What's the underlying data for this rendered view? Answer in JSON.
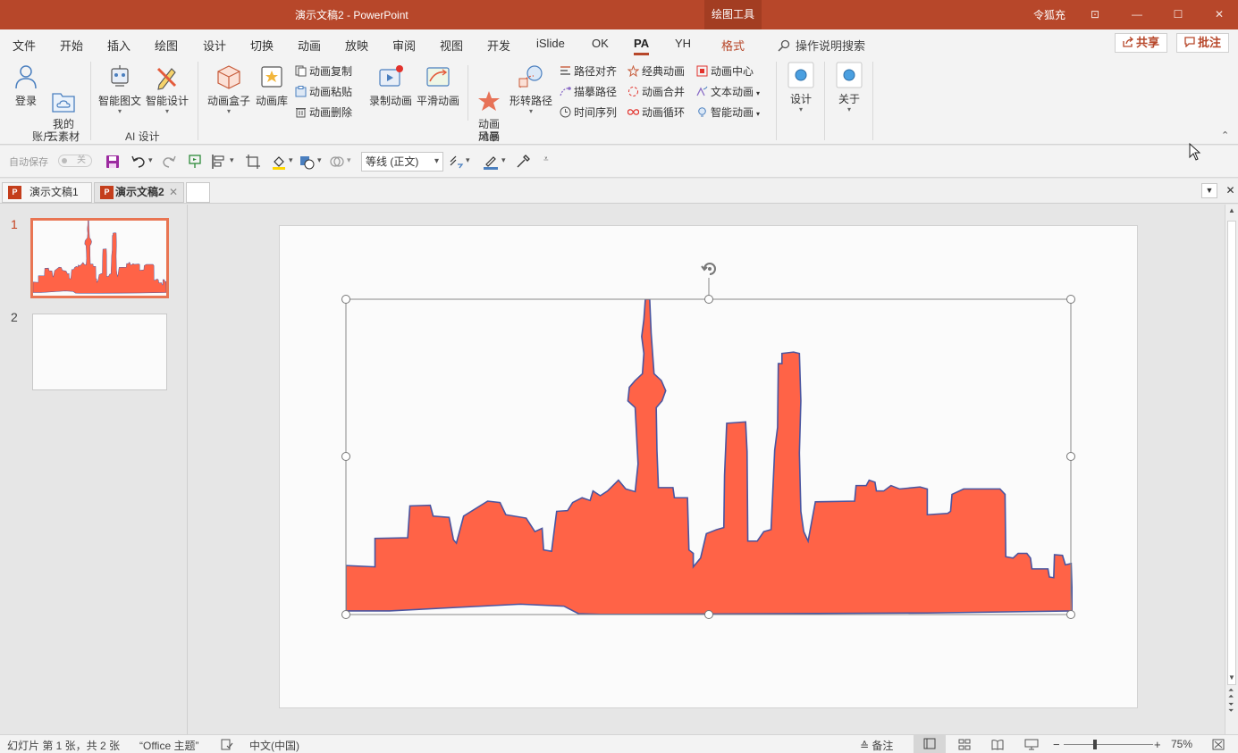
{
  "titlebar": {
    "title": "演示文稿2  -  PowerPoint",
    "tools_badge": "绘图工具",
    "user": "令狐充",
    "btn_ribbon_options": "⊡",
    "btn_minimize": "—",
    "btn_maximize": "☐",
    "btn_close": "✕"
  },
  "menu": {
    "tabs": [
      "文件",
      "开始",
      "插入",
      "绘图",
      "设计",
      "切换",
      "动画",
      "放映",
      "审阅",
      "视图",
      "开发",
      "iSlide",
      "OK",
      "PA",
      "YH",
      "格式"
    ],
    "active_tab": "PA",
    "search": "操作说明搜索",
    "share": "共享",
    "comments": "批注"
  },
  "ribbon": {
    "account_group": {
      "label": "账户",
      "login": "登录",
      "my_assets": "我的\n云素材"
    },
    "ai_group": {
      "label": "AI 设计",
      "smart_graphics": "智能图文",
      "smart_design": "智能设计"
    },
    "anim_group": {
      "label": "动画",
      "anim_box": "动画盒子",
      "anim_library": "动画库",
      "anim_copy": "动画复制",
      "anim_paste": "动画粘贴",
      "anim_delete": "动画删除",
      "record_anim": "录制动画",
      "smooth_anim": "平滑动画",
      "anim_storm": "动画\n风暴",
      "morph_path": "形转路径",
      "path_align": "路径对齐",
      "trace_path": "描摹路径",
      "time_sequence": "时间序列",
      "classic_anim": "经典动画",
      "anim_merge": "动画合并",
      "anim_loop": "动画循环",
      "anim_center": "动画中心",
      "text_anim": "文本动画",
      "smart_anim": "智能动画"
    },
    "design_btn": "设计",
    "about_btn": "关于"
  },
  "qat": {
    "autosave_label": "自动保存",
    "autosave_state": "关",
    "font_name": "等线 (正文)"
  },
  "doc_tabs": [
    {
      "label": "演示文稿1",
      "active": false
    },
    {
      "label": "演示文稿2",
      "active": true
    }
  ],
  "slides": [
    {
      "number": "1",
      "active": true
    },
    {
      "number": "2",
      "active": false
    }
  ],
  "status": {
    "slide_info": "幻灯片 第 1 张，共 2 张",
    "theme": "“Office 主题”",
    "language": "中文(中国)",
    "notes": "备注",
    "zoom": "75%",
    "zoom_level": 0.75
  },
  "colors": {
    "brand": "#b7472a",
    "skyline_fill": "#ff6347",
    "skyline_stroke": "#4a55a0"
  }
}
